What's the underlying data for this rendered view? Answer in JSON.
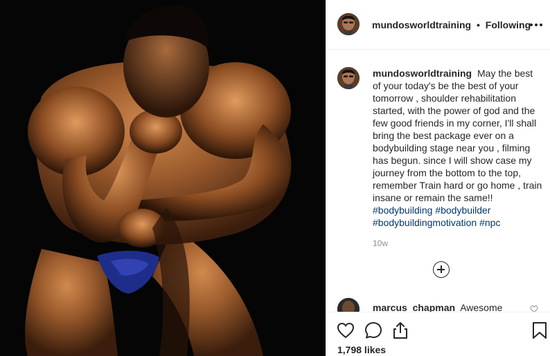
{
  "post": {
    "username": "mundosworldtraining",
    "follow_separator": "•",
    "follow_status": "Following",
    "caption_text": "May the best of your today's be the best of your tomorrow , shoulder rehabilitation started, with the power of god and the few good friends in my corner, I'll shall bring the best package ever on a bodybuilding stage near you , filming has begun. since I will show case my journey from the bottom to the top, remember Train hard or go home , train insane or remain the same!!",
    "hashtags": "#bodybuilding #bodybuilder #bodybuildingmotivation #npc",
    "timestamp": "10w",
    "likes": "1,798 likes"
  },
  "comments": [
    {
      "username": "marcus_chapman",
      "text": "Awesome"
    }
  ],
  "icons": {
    "more": "more-options-icon",
    "load_more": "plus-circle-icon",
    "like": "heart-icon",
    "comment": "comment-icon",
    "share": "share-icon",
    "save": "bookmark-icon"
  },
  "colors": {
    "hashtag": "#00376b",
    "muted": "#8e8e8e",
    "text": "#262626",
    "divider": "#efefef"
  }
}
